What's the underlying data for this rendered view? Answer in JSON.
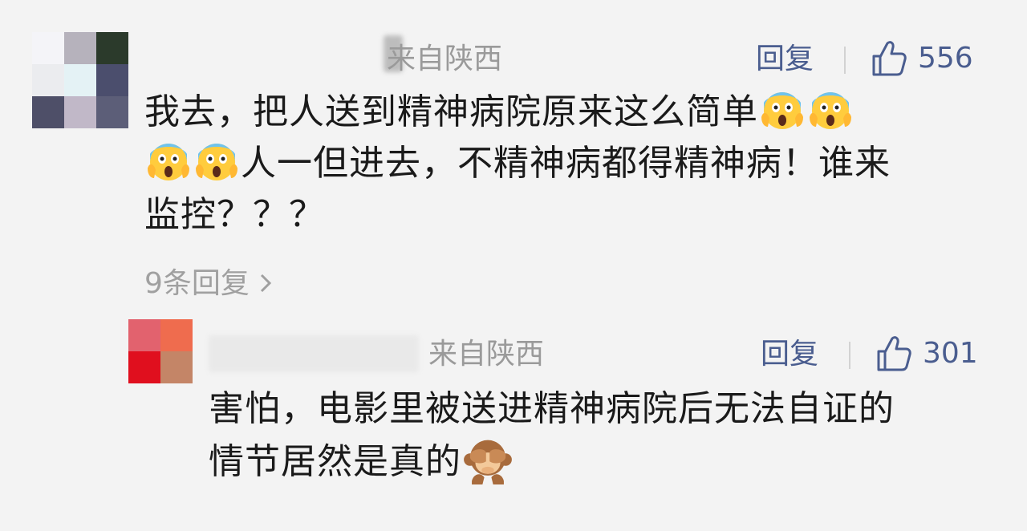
{
  "comments": [
    {
      "location": "来自陕西",
      "location_partial": "来自陕西",
      "reply_label": "回复",
      "like_icon": "thumbs-up-icon",
      "likes": "556",
      "text_line1": "我去，把人送到精神病院原来这么简单",
      "text_line2": "人一但进去，不精神病都得精神病！谁来",
      "text_line3": "监控？？？",
      "emoji": "face-screaming-in-fear-icon",
      "more_replies": "9条回复",
      "more_icon": "chevron-right-icon"
    },
    {
      "location": "来自陕西",
      "reply_label": "回复",
      "like_icon": "thumbs-up-icon",
      "likes": "301",
      "text_line1": "害怕，电影里被送进精神病院后无法自证的",
      "text_line2": "情节居然是真的",
      "emoji": "see-no-evil-monkey-icon"
    }
  ],
  "colors": {
    "accent": "#4a5d8f",
    "muted": "#9a9a9a",
    "background": "#f3f3f3",
    "avatar1": [
      "#f4f4f8",
      "#b6b2bc",
      "#2b3a2b",
      "#ebecef",
      "#e4f2f5",
      "#4b4e6d",
      "#4e4f68",
      "#c1b8c8",
      "#5c5e78"
    ],
    "avatar2": [
      "#e2626e",
      "#ef6c4e",
      "#e00f1e",
      "#c48567"
    ]
  }
}
